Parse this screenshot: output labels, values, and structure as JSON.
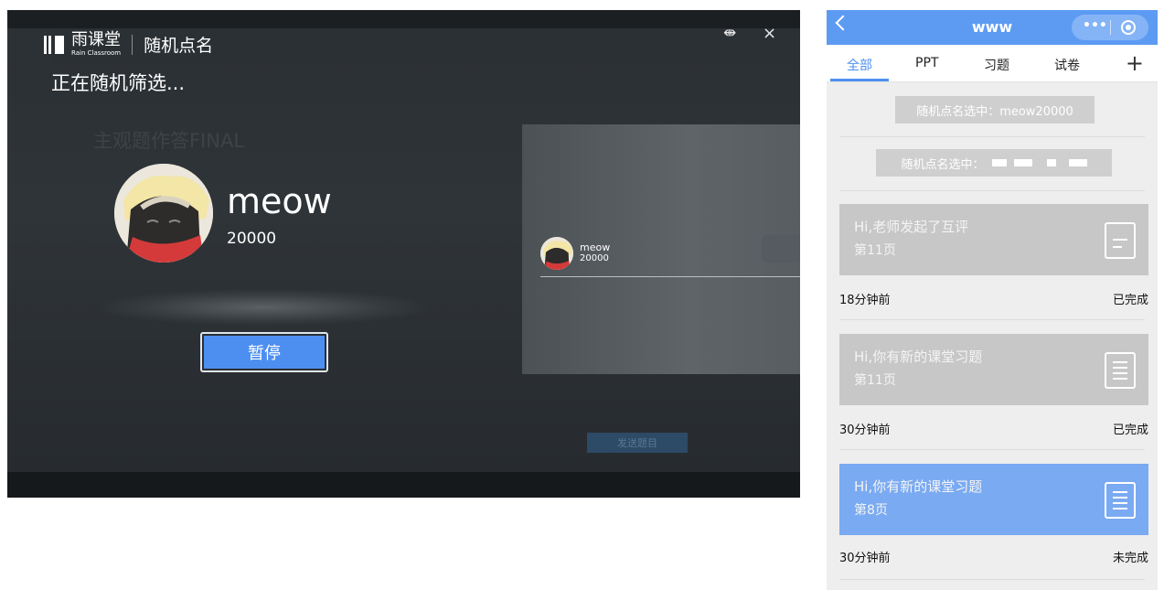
{
  "desktop": {
    "brand_name": "雨课堂",
    "brand_sub": "Rain Classroom",
    "window_title": "随机点名",
    "status_text": "正在随机筛选...",
    "question_title": "主观题作答FINAL",
    "selected_user": {
      "name": "meow",
      "id": "20000"
    },
    "pause_label": "暂停",
    "preview_user": {
      "name": "meow",
      "id": "20000"
    },
    "ghost_button_label": "发送题目",
    "controls": {
      "shrink": "⇼",
      "close": "×"
    }
  },
  "phone": {
    "nav_title": "www",
    "tabs": [
      {
        "label": "全部",
        "active": true
      },
      {
        "label": "PPT"
      },
      {
        "label": "习题"
      },
      {
        "label": "试卷"
      }
    ],
    "plus_label": "+",
    "notice_1": "随机点名选中：meow20000",
    "notice_2": "随机点名选中：",
    "cards": [
      {
        "line1": "Hi,老师发起了互评",
        "line2": "第11页",
        "time": "18分钟前",
        "status": "已完成",
        "icon": "peer-review-icon",
        "color": "#c7c7c7"
      },
      {
        "line1": "Hi,你有新的课堂习题",
        "line2": "第11页",
        "time": "30分钟前",
        "status": "已完成",
        "icon": "document-icon",
        "color": "#c7c7c7"
      },
      {
        "line1": "Hi,你有新的课堂习题",
        "line2": "第8页",
        "time": "30分钟前",
        "status": "未完成",
        "icon": "document-icon",
        "color": "#7aaaf2"
      }
    ]
  },
  "colors": {
    "accent": "#4d8ff0",
    "nav": "#5d9bf3",
    "stage": "#2f3438"
  }
}
